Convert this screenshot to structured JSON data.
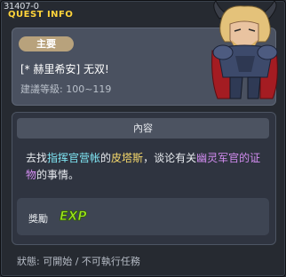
{
  "window": {
    "quest_id": "31407-0",
    "title": "QUEST INFO"
  },
  "quest": {
    "tag": "主要",
    "name": "[* 赫里希安] 无双!",
    "level": "建議等級: 100~119"
  },
  "content": {
    "header": "內容",
    "desc_parts": [
      "去找",
      "指挥官营帐",
      "的",
      "皮塔斯",
      "，谈论有关",
      "幽灵军官的证物",
      "的事情。"
    ]
  },
  "reward": {
    "label": "獎勵",
    "icon": "exp-icon",
    "icon_text": "EXP"
  },
  "status": {
    "text": "狀態:  可開始 / 不可執行任務"
  },
  "colors": {
    "title": "#ffd43a",
    "highlight_cyan": "#7fe6f4",
    "highlight_yellow": "#f5d86b",
    "highlight_purple": "#d28cf0",
    "exp_green": "#9be21e"
  }
}
